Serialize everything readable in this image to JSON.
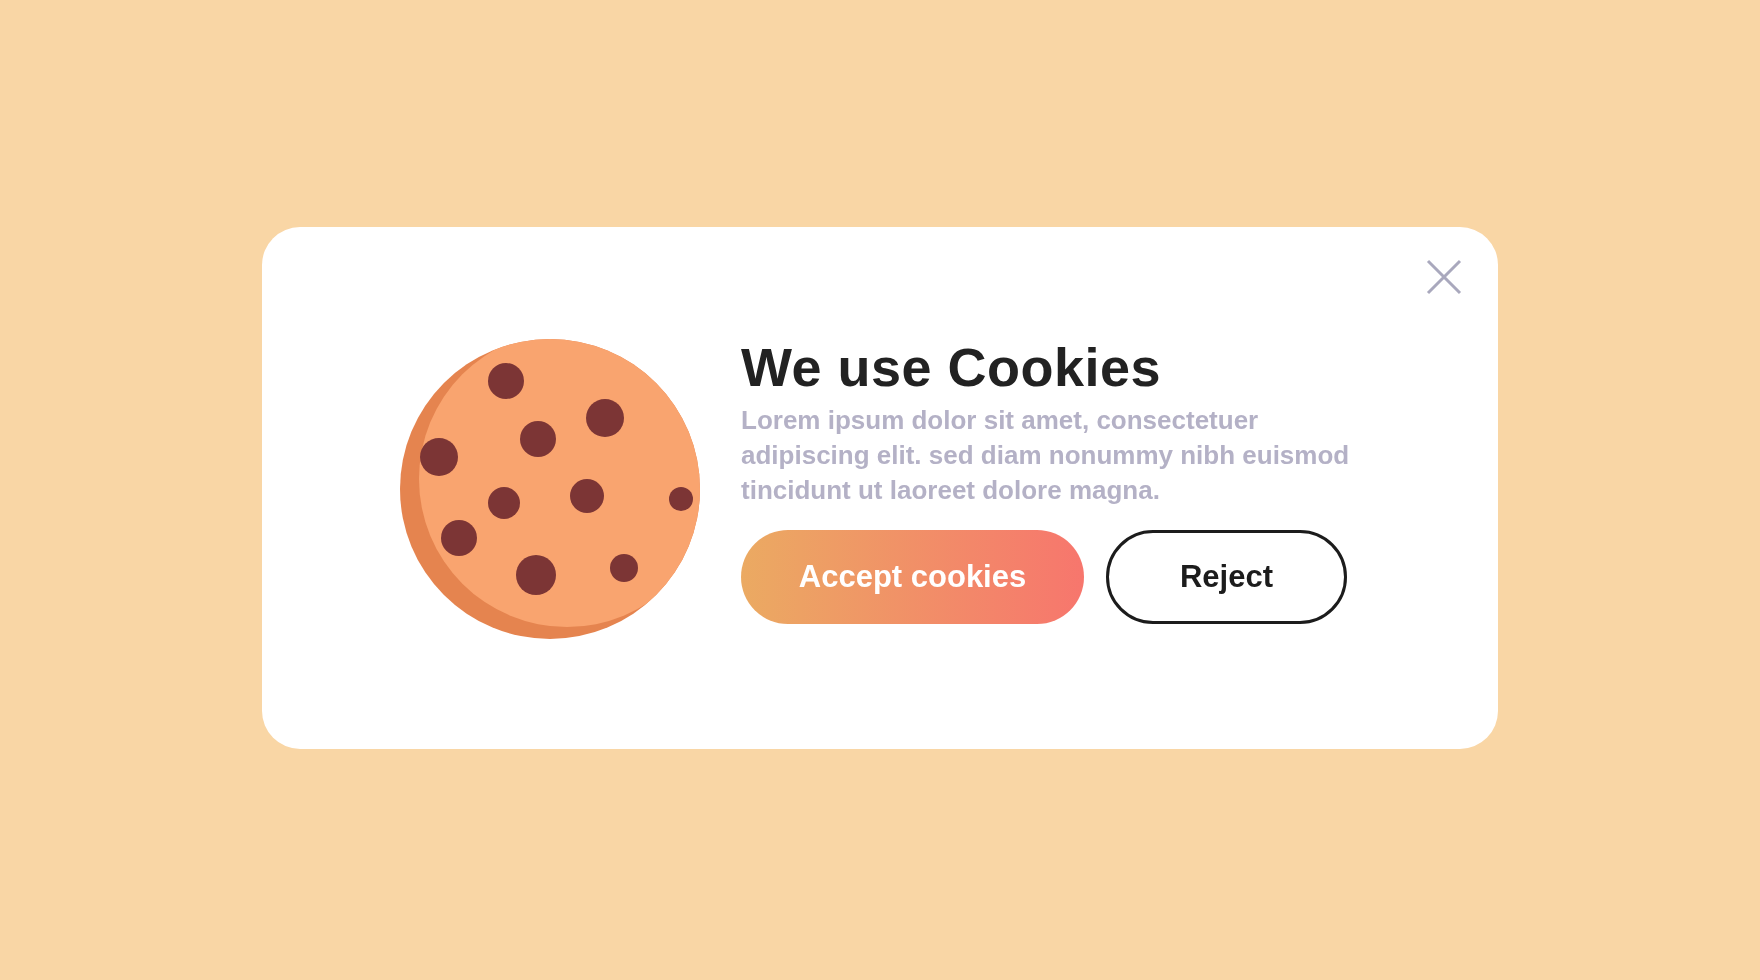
{
  "dialog": {
    "title": "We use Cookies",
    "message": "Lorem ipsum dolor sit amet, consectetuer adipiscing elit. sed diam nonummy nibh euismod tincidunt ut laoreet dolore magna.",
    "buttons": [
      {
        "label": "Accept cookies",
        "kind": "primary"
      },
      {
        "label": "Reject",
        "kind": "outline"
      }
    ]
  }
}
